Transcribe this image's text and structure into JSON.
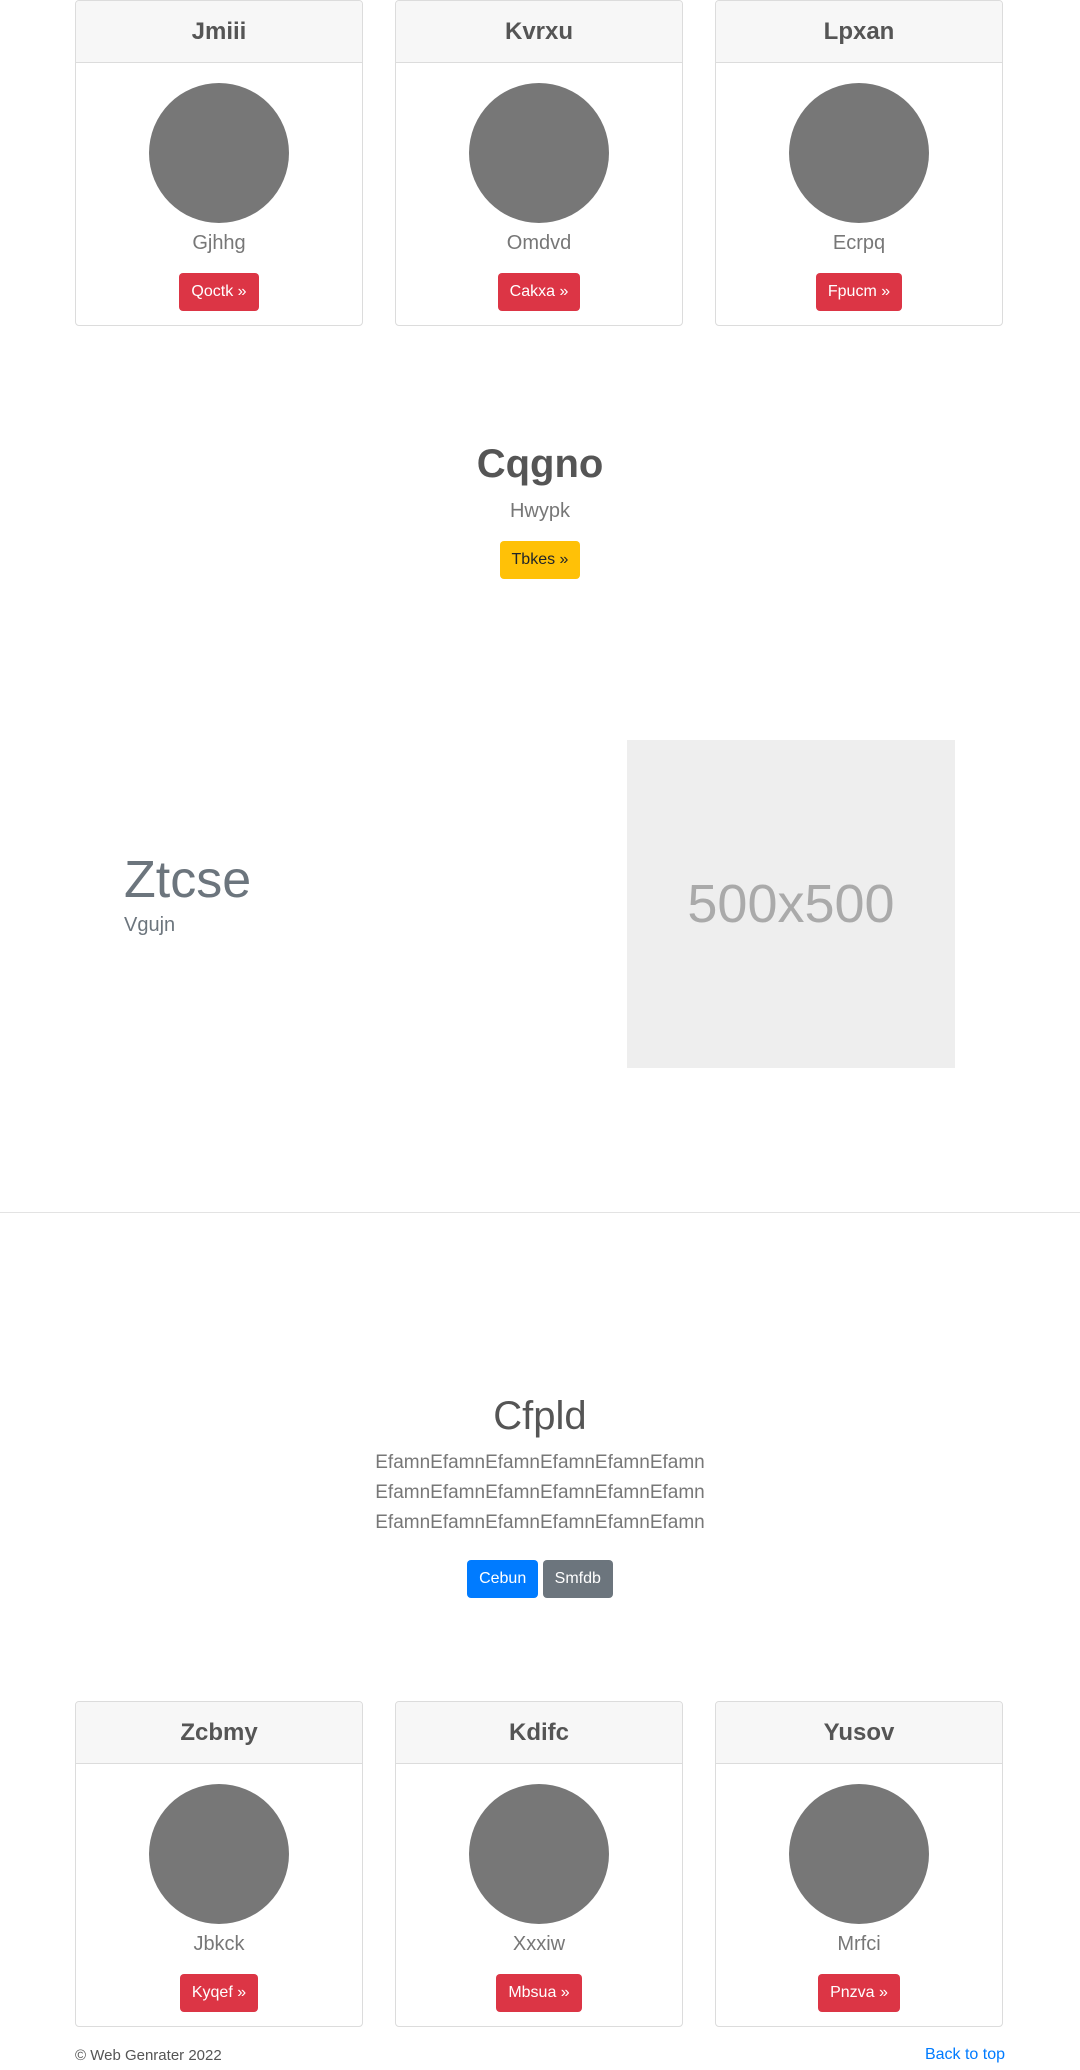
{
  "top_cards": [
    {
      "title": "Jmiii",
      "text": "Gjhhg",
      "button": "Qoctk »"
    },
    {
      "title": "Kvrxu",
      "text": "Omdvd",
      "button": "Cakxa »"
    },
    {
      "title": "Lpxan",
      "text": "Ecrpq",
      "button": "Fpucm »"
    }
  ],
  "hero": {
    "title": "Cqgno",
    "subtitle": "Hwypk",
    "button": "Tbkes »"
  },
  "feature": {
    "title": "Ztcse",
    "subtitle": "Vgujn",
    "image_label": "500x500"
  },
  "jumbotron": {
    "title": "Cfpld",
    "lines": [
      "EfamnEfamnEfamnEfamnEfamnEfamn",
      "EfamnEfamnEfamnEfamnEfamnEfamn",
      "EfamnEfamnEfamnEfamnEfamnEfamn"
    ],
    "primary_button": "Cebun",
    "secondary_button": "Smfdb"
  },
  "bottom_cards": [
    {
      "title": "Zcbmy",
      "text": "Jbkck",
      "button": "Kyqef »"
    },
    {
      "title": "Kdifc",
      "text": "Xxxiw",
      "button": "Mbsua »"
    },
    {
      "title": "Yusov",
      "text": "Mrfci",
      "button": "Pnzva »"
    }
  ],
  "footer": {
    "copyright": "© Web Genrater 2022",
    "back_to_top": "Back to top"
  },
  "colors": {
    "danger": "#dc3545",
    "warning": "#ffc107",
    "primary": "#007bff",
    "secondary": "#6c757d",
    "avatar": "#777777"
  }
}
